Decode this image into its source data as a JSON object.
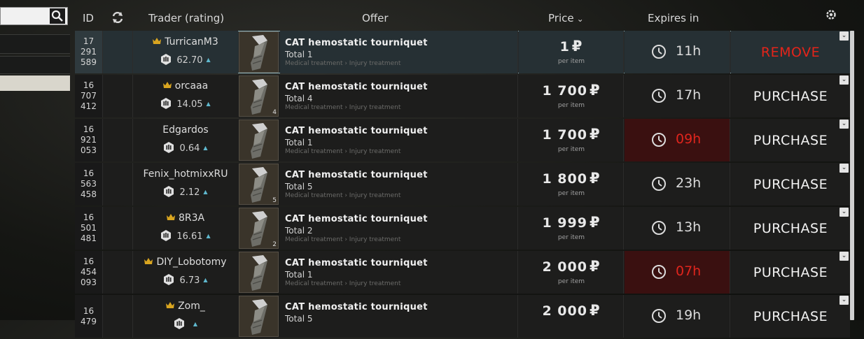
{
  "header": {
    "id_label": "ID",
    "trader_label": "Trader (rating)",
    "offer_label": "Offer",
    "price_label": "Price",
    "price_sort_indicator": "⌄",
    "expires_label": "Expires in"
  },
  "search": {
    "value": "",
    "placeholder": ""
  },
  "rows": [
    {
      "id": [
        "17",
        "291",
        "589"
      ],
      "trader": "TurricanM3",
      "crown": true,
      "rating": "62.70",
      "count": "",
      "item": "CAT hemostatic tourniquet",
      "total": "Total 1",
      "category": "Medical treatment › Injury treatment",
      "price": "1",
      "per_item": "per item",
      "expires": "11h",
      "urgent": false,
      "action": "REMOVE"
    },
    {
      "id": [
        "16",
        "707",
        "412"
      ],
      "trader": "orcaaa",
      "crown": true,
      "rating": "14.05",
      "count": "4",
      "item": "CAT hemostatic tourniquet",
      "total": "Total 4",
      "category": "Medical treatment › Injury treatment",
      "price": "1 700",
      "per_item": "per item",
      "expires": "17h",
      "urgent": false,
      "action": "PURCHASE"
    },
    {
      "id": [
        "16",
        "921",
        "053"
      ],
      "trader": "Edgardos",
      "crown": false,
      "rating": "0.64",
      "count": "",
      "item": "CAT hemostatic tourniquet",
      "total": "Total 1",
      "category": "Medical treatment › Injury treatment",
      "price": "1 700",
      "per_item": "per item",
      "expires": "09h",
      "urgent": true,
      "action": "PURCHASE"
    },
    {
      "id": [
        "16",
        "563",
        "458"
      ],
      "trader": "Fenix_hotmixxRU",
      "crown": false,
      "rating": "2.12",
      "count": "5",
      "item": "CAT hemostatic tourniquet",
      "total": "Total 5",
      "category": "Medical treatment › Injury treatment",
      "price": "1 800",
      "per_item": "per item",
      "expires": "23h",
      "urgent": false,
      "action": "PURCHASE"
    },
    {
      "id": [
        "16",
        "501",
        "481"
      ],
      "trader": "8R3A",
      "crown": true,
      "rating": "16.61",
      "count": "2",
      "item": "CAT hemostatic tourniquet",
      "total": "Total 2",
      "category": "Medical treatment › Injury treatment",
      "price": "1 999",
      "per_item": "per item",
      "expires": "13h",
      "urgent": false,
      "action": "PURCHASE"
    },
    {
      "id": [
        "16",
        "454",
        "093"
      ],
      "trader": "DIY_Lobotomy",
      "crown": true,
      "rating": "6.73",
      "count": "",
      "item": "CAT hemostatic tourniquet",
      "total": "Total 1",
      "category": "Medical treatment › Injury treatment",
      "price": "2 000",
      "per_item": "per item",
      "expires": "07h",
      "urgent": true,
      "action": "PURCHASE"
    },
    {
      "id": [
        "16",
        "479",
        ""
      ],
      "trader": "Zom_",
      "crown": true,
      "rating": "",
      "count": "",
      "item": "CAT hemostatic tourniquet",
      "total": "Total 5",
      "category": "",
      "price": "2 000",
      "per_item": "",
      "expires": "19h",
      "urgent": false,
      "action": "PURCHASE"
    }
  ],
  "currency_symbol": "₽",
  "colors": {
    "accent_blue": "#5fb8ce",
    "danger_red": "#e0251d",
    "urgent_bg": "#3a1010"
  }
}
